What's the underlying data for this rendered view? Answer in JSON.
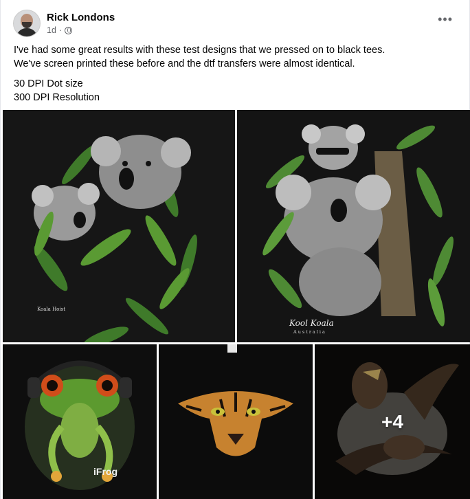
{
  "post": {
    "author": "Rick Londons",
    "time": "1d",
    "separator": "·",
    "privacy_icon": "globe-icon",
    "more_icon": "more-dots-icon",
    "more_label": "•••",
    "text_lines": [
      "I've had some great results with these test designs that we pressed on to black tees.",
      "We've screen printed these before and the dtf transfers were almost identical.",
      "30 DPI Dot size",
      "300 DPI Resolution"
    ]
  },
  "gallery": {
    "photos": [
      {
        "subject": "koala-with-joey-in-eucalyptus-leaves",
        "caption": "Koala Hoist"
      },
      {
        "subject": "koala-carrying-joey-on-tree",
        "caption": "Kool Koala",
        "caption2": "Australia"
      },
      {
        "subject": "green-frog-with-headphones",
        "caption": "iFrog"
      },
      {
        "subject": "tiger-face",
        "caption": ""
      },
      {
        "subject": "eagles-in-flight",
        "caption": ""
      }
    ],
    "more_count": "+4"
  }
}
